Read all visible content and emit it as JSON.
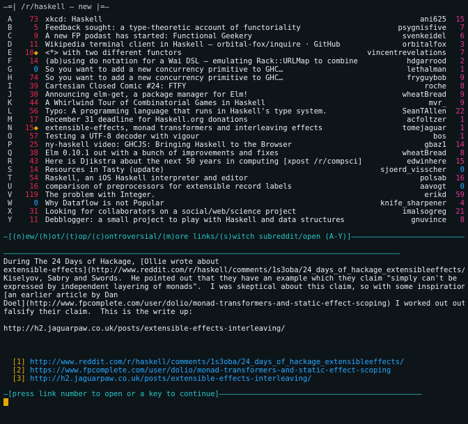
{
  "header": {
    "prefix": "—=| ",
    "subreddit": "/r/haskell",
    "sep": " — ",
    "sort": "new",
    "suffix": " |=—"
  },
  "posts": [
    {
      "key": "A",
      "score": "73",
      "score_color": "red",
      "star": "",
      "title": "xkcd: Haskell",
      "author": "ani625",
      "comments": "15",
      "comments_color": "magenta"
    },
    {
      "key": "B",
      "score": "5",
      "score_color": "red",
      "star": "",
      "title": "Feedback sought: a type-theoretic account of functoriality",
      "author": "psygnisfive",
      "comments": "7",
      "comments_color": "magenta"
    },
    {
      "key": "C",
      "score": "9",
      "score_color": "red",
      "star": "",
      "title": "A new FP podast has started: Functional Geekery",
      "author": "svenkeidel",
      "comments": "6",
      "comments_color": "magenta"
    },
    {
      "key": "D",
      "score": "11",
      "score_color": "red",
      "star": "",
      "title": "Wikipedia terminal client in Haskell — orbital-fox/inquire · GitHub",
      "author": "orbitalfox",
      "comments": "3",
      "comments_color": "magenta"
    },
    {
      "key": "E",
      "score": "10",
      "score_color": "red",
      "star": "◆",
      "title": "<*> with two different functors",
      "author": "vincentrevelations",
      "comments": "7",
      "comments_color": "magenta"
    },
    {
      "key": "F",
      "score": "14",
      "score_color": "red",
      "star": "",
      "title": "(ab)using do notation for a Wai DSL — emulating Rack::URLMap to combine",
      "author": "hdgarrood",
      "comments": "2",
      "comments_color": "magenta"
    },
    {
      "key": "G",
      "score": "0",
      "score_color": "blue",
      "star": "",
      "title": "So you want to add a new concurrency primitive to GHC…",
      "author": "lethalman",
      "comments": "1",
      "comments_color": "magenta"
    },
    {
      "key": "H",
      "score": "74",
      "score_color": "red",
      "star": "",
      "title": "So you want to add a new concurrency primitive to GHC…",
      "author": "fryguybob",
      "comments": "9",
      "comments_color": "magenta"
    },
    {
      "key": "I",
      "score": "39",
      "score_color": "red",
      "star": "",
      "title": "Cartesian Closed Comic #24: FTFY",
      "author": "roche",
      "comments": "8",
      "comments_color": "magenta"
    },
    {
      "key": "J",
      "score": "30",
      "score_color": "red",
      "star": "",
      "title": "Announcing elm-get, a package manager for Elm!",
      "author": "wheatBread",
      "comments": "9",
      "comments_color": "magenta"
    },
    {
      "key": "K",
      "score": "44",
      "score_color": "red",
      "star": "",
      "title": "A Whirlwind Tour of Combinatorial Games in Haskell",
      "author": "mvr_",
      "comments": "9",
      "comments_color": "magenta"
    },
    {
      "key": "L",
      "score": "56",
      "score_color": "red",
      "star": "",
      "title": "Typo: A programming language that runs in Haskell's type system.",
      "author": "SeanTAllen",
      "comments": "22",
      "comments_color": "magenta"
    },
    {
      "key": "M",
      "score": "17",
      "score_color": "red",
      "star": "",
      "title": "December 31 deadline for Haskell.org donations",
      "author": "acfoltzer",
      "comments": "1",
      "comments_color": "magenta"
    },
    {
      "key": "N",
      "score": "15",
      "score_color": "red",
      "star": "◆",
      "title": "extensible-effects, monad transformers and interleaving effects",
      "author": "tomejaguar",
      "comments": "1",
      "comments_color": "magenta"
    },
    {
      "key": "O",
      "score": "57",
      "score_color": "red",
      "star": "",
      "title": "Testing a UTF-8 decoder with vigour",
      "author": "bos",
      "comments": "1",
      "comments_color": "magenta"
    },
    {
      "key": "P",
      "score": "25",
      "score_color": "red",
      "star": "",
      "title": "ny-haskell video: GHCJS: Bringing Haskell to the Browser",
      "author": "gbaz1",
      "comments": "14",
      "comments_color": "magenta"
    },
    {
      "key": "Q",
      "score": "38",
      "score_color": "red",
      "star": "",
      "title": "Elm 0.10.1 out with a bunch of improvements and fixes",
      "author": "wheatBread",
      "comments": "8",
      "comments_color": "magenta"
    },
    {
      "key": "R",
      "score": "43",
      "score_color": "red",
      "star": "",
      "title": "Here is Djikstra about the next 50 years in computing [xpost /r/compsci]",
      "author": "edwinhere",
      "comments": "15",
      "comments_color": "magenta"
    },
    {
      "key": "S",
      "score": "14",
      "score_color": "red",
      "star": "",
      "title": "Resources in Tasty (update)",
      "author": "sjoerd_visscher",
      "comments": "0",
      "comments_color": "blue"
    },
    {
      "key": "T",
      "score": "54",
      "score_color": "red",
      "star": "",
      "title": "Raskell, an iOS Haskell interpreter and editor",
      "author": "polsab",
      "comments": "16",
      "comments_color": "magenta"
    },
    {
      "key": "U",
      "score": "16",
      "score_color": "red",
      "star": "",
      "title": "comparison of preprocessors for extensible record labels",
      "author": "aavogt",
      "comments": "0",
      "comments_color": "blue"
    },
    {
      "key": "V",
      "score": "119",
      "score_color": "red",
      "star": "",
      "title": "The problem with Integer.",
      "author": "erikd",
      "comments": "59",
      "comments_color": "magenta"
    },
    {
      "key": "W",
      "score": "0",
      "score_color": "blue",
      "star": "",
      "title": "Why Dataflow is not Popular",
      "author": "knife_sharpener",
      "comments": "4",
      "comments_color": "magenta"
    },
    {
      "key": "X",
      "score": "31",
      "score_color": "red",
      "star": "",
      "title": "Looking for collaborators on a social/web/science project",
      "author": "imalsogreg",
      "comments": "21",
      "comments_color": "magenta"
    },
    {
      "key": "Y",
      "score": "11",
      "score_color": "red",
      "star": "",
      "title": "Debblogger: a small project to play with Haskell and data structures",
      "author": "gnuvince",
      "comments": "8",
      "comments_color": "magenta"
    }
  ],
  "navbar": "—[(n)ew/(h)ot/(t)op/(c)ontroversial/(m)ore links/(s)witch subreddit/open (A-Y)]——————————————————————————",
  "divider": "——————————————————————————————————————————————————————————————————————————————————————————",
  "post_body": [
    "During The 24 Days of Hackage, [Ollie wrote about",
    "extensible-effects](http://www.reddit.com/r/haskell/comments/1s3oba/24_days_of_hackage_extensibleeffects/) by",
    "Kiselyov, Sabry and Swords.  He pointed out that they have an example which they claim \"simply can't be",
    "expressed by independent layering of monads\".  I was skeptical about this claim, so with some inspiration from",
    "[an earlier article by Dan",
    "Doel](http://www.fpcomplete.com/user/dolio/monad-transformers-and-static-effect-scoping) I worked out out to",
    "falsify their claim.  This is the write up:",
    "",
    "http://h2.jaguarpaw.co.uk/posts/extensible-effects-interleaving/"
  ],
  "links": [
    {
      "num": "[1]",
      "url": "http://www.reddit.com/r/haskell/comments/1s3oba/24_days_of_hackage_extensibleeffects/"
    },
    {
      "num": "[2]",
      "url": "https://www.fpcomplete.com/user/dolio/monad-transformers-and-static-effect-scoping"
    },
    {
      "num": "[3]",
      "url": "http://h2.jaguarpaw.co.uk/posts/extensible-effects-interleaving/"
    }
  ],
  "footer": "—[press link number to open or a key to continue]——————————————————————————————————————————————",
  "colors": {
    "background": "#0d1519",
    "score_red": "#e8274d",
    "score_blue": "#2aa6ff",
    "comments_magenta": "#e8338f",
    "accent_cyan": "#2ac4c4",
    "link_gold": "#e6a800"
  }
}
